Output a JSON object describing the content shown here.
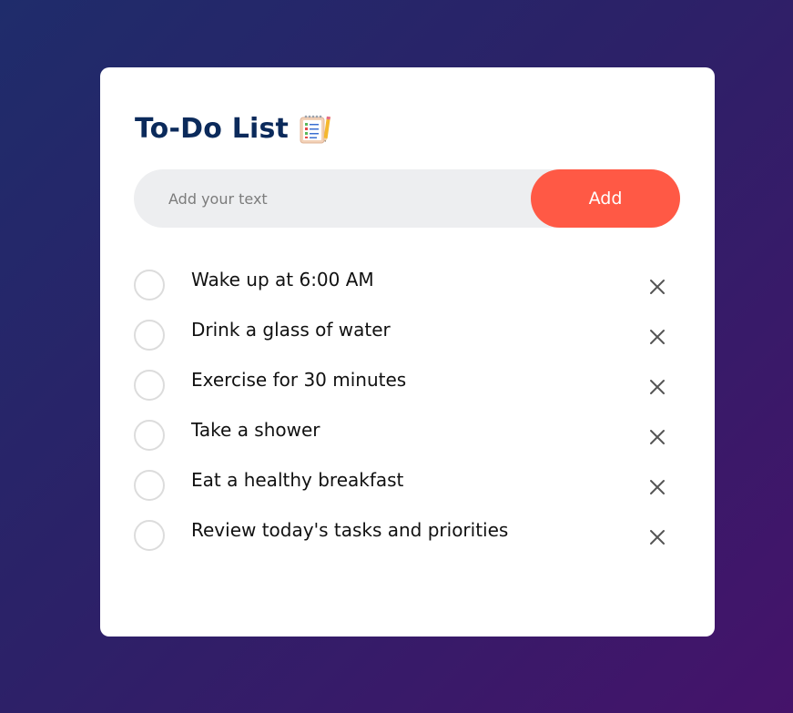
{
  "app": {
    "title": "To-Do List",
    "title_icon": "notepad-checklist-icon"
  },
  "input": {
    "placeholder": "Add your text",
    "value": ""
  },
  "add_button": {
    "label": "Add",
    "color": "#ff5945"
  },
  "colors": {
    "title": "#0b2a5b",
    "background_start": "#1f2c6b",
    "background_end": "#45136a",
    "card": "#ffffff"
  },
  "tasks": [
    {
      "text": "Wake up at 6:00 AM",
      "checked": false,
      "remove_icon": "close-icon"
    },
    {
      "text": "Drink a glass of water",
      "checked": false,
      "remove_icon": "close-icon"
    },
    {
      "text": "Exercise for 30 minutes",
      "checked": false,
      "remove_icon": "close-icon"
    },
    {
      "text": "Take a shower",
      "checked": false,
      "remove_icon": "close-icon"
    },
    {
      "text": "Eat a healthy breakfast",
      "checked": false,
      "remove_icon": "close-icon"
    },
    {
      "text": "Review today's tasks and priorities",
      "checked": false,
      "remove_icon": "close-icon"
    }
  ]
}
